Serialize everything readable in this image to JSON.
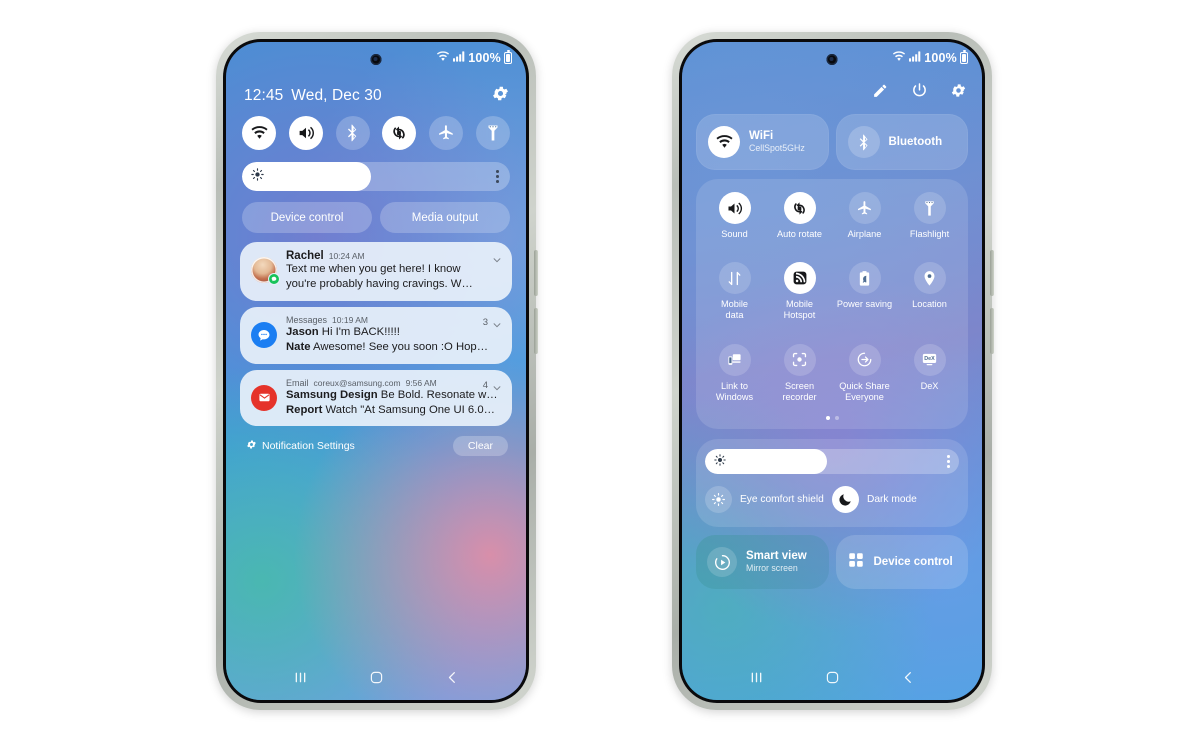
{
  "phone1": {
    "status": {
      "battery_text": "100%",
      "wifi_icon": "wifi-icon",
      "signal_icon": "cellular-signal-icon",
      "battery_icon": "battery-icon"
    },
    "header": {
      "time": "12:45",
      "date": "Wed, Dec 30",
      "settings_icon": "gear-icon"
    },
    "toggles": [
      {
        "name": "wifi",
        "icon": "wifi-icon",
        "on": true
      },
      {
        "name": "sound",
        "icon": "volume-icon",
        "on": true
      },
      {
        "name": "bluetooth",
        "icon": "bluetooth-icon",
        "on": false
      },
      {
        "name": "auto-rotate",
        "icon": "auto-rotate-icon",
        "on": true
      },
      {
        "name": "airplane",
        "icon": "airplane-icon",
        "on": false
      },
      {
        "name": "flashlight",
        "icon": "flashlight-icon",
        "on": false
      }
    ],
    "brightness": {
      "value": 48,
      "icon": "brightness-icon",
      "menu_icon": "more-vertical-icon"
    },
    "pills": [
      {
        "label": "Device control"
      },
      {
        "label": "Media output"
      }
    ],
    "notifications": [
      {
        "type": "person",
        "name": "Rachel",
        "time": "10:24 AM",
        "lines": [
          {
            "text": "Text me when you get here! I know"
          },
          {
            "text": "you're probably having cravings. W…"
          }
        ],
        "badge_icon": "message-badge-icon",
        "chevron_icon": "chevron-down-icon"
      },
      {
        "type": "messages",
        "app": "Messages",
        "time": "10:19 AM",
        "count": "3",
        "icon": "messages-icon",
        "lines": [
          {
            "sender": "Jason",
            "text": "Hi I'm BACK!!!!!"
          },
          {
            "sender": "Nate",
            "text": "Awesome! See you soon :O Hop…"
          }
        ],
        "chevron_icon": "chevron-down-icon"
      },
      {
        "type": "email",
        "app": "Email",
        "account": "coreux@samsung.com",
        "time": "9:56 AM",
        "count": "4",
        "icon": "email-icon",
        "lines": [
          {
            "sender": "Samsung Design",
            "text": "Be Bold. Resonate w…"
          },
          {
            "sender": "Report",
            "text": "Watch \"At Samsung One UI 6.0…"
          }
        ],
        "chevron_icon": "chevron-down-icon"
      }
    ],
    "footer": {
      "settings_label": "Notification Settings",
      "settings_icon": "gear-icon",
      "clear_label": "Clear"
    },
    "nav": {
      "recents_icon": "recents-icon",
      "home_icon": "home-icon",
      "back_icon": "back-icon"
    }
  },
  "phone2": {
    "status": {
      "battery_text": "100%",
      "wifi_icon": "wifi-icon",
      "signal_icon": "cellular-signal-icon",
      "battery_icon": "battery-icon"
    },
    "top_icons": [
      {
        "name": "edit-icon",
        "label": "Edit"
      },
      {
        "name": "power-icon",
        "label": "Power"
      },
      {
        "name": "gear-icon",
        "label": "Settings"
      }
    ],
    "big_tiles": [
      {
        "title": "WiFi",
        "subtitle": "CellSpot5GHz",
        "icon": "wifi-icon",
        "on": true
      },
      {
        "title": "Bluetooth",
        "subtitle": "",
        "icon": "bluetooth-icon",
        "on": false
      }
    ],
    "grid": [
      {
        "label": "Sound",
        "icon": "volume-icon",
        "on": true
      },
      {
        "label": "Auto rotate",
        "icon": "auto-rotate-icon",
        "on": true
      },
      {
        "label": "Airplane",
        "icon": "airplane-icon",
        "on": false
      },
      {
        "label": "Flashlight",
        "icon": "flashlight-icon",
        "on": false
      },
      {
        "label": "Mobile\ndata",
        "icon": "mobile-data-icon",
        "on": false
      },
      {
        "label": "Mobile\nHotspot",
        "icon": "hotspot-icon",
        "on": true
      },
      {
        "label": "Power saving",
        "icon": "power-saving-icon",
        "on": false
      },
      {
        "label": "Location",
        "icon": "location-pin-icon",
        "on": false
      },
      {
        "label": "Link to\nWindows",
        "icon": "link-to-windows-icon",
        "on": false
      },
      {
        "label": "Screen\nrecorder",
        "icon": "screen-recorder-icon",
        "on": false
      },
      {
        "label": "Quick Share\nEveryone",
        "icon": "quick-share-icon",
        "on": false
      },
      {
        "label": "DeX",
        "icon": "dex-icon",
        "on": false
      }
    ],
    "page_dots": {
      "total": 2,
      "active": 1
    },
    "brightness": {
      "value": 48,
      "icon": "brightness-icon",
      "menu_icon": "more-vertical-icon"
    },
    "mode_row": [
      {
        "label": "Eye comfort shield",
        "icon": "eye-comfort-icon",
        "on": false
      },
      {
        "label": "Dark mode",
        "icon": "moon-icon",
        "on": true
      }
    ],
    "bottom_tiles": [
      {
        "title": "Smart view",
        "subtitle": "Mirror screen",
        "icon": "smart-view-icon"
      },
      {
        "title": "Device control",
        "subtitle": "",
        "icon": "device-control-icon"
      }
    ],
    "nav": {
      "recents_icon": "recents-icon",
      "home_icon": "home-icon",
      "back_icon": "back-icon"
    }
  }
}
